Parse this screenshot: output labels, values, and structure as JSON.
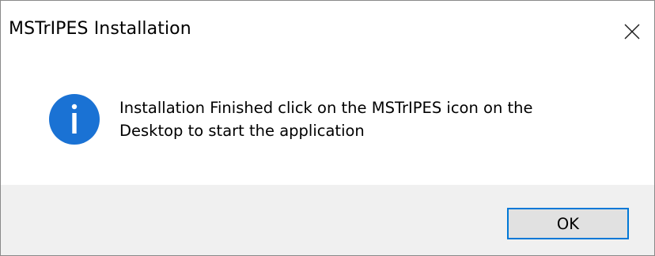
{
  "window": {
    "title": "MSTrIPES Installation",
    "close_icon": "close-icon"
  },
  "content": {
    "icon": "information-icon",
    "icon_color": "#1a72d4",
    "message_lines": [
      "Installation Finished click on the MSTrIPES icon on the",
      "Desktop to start the application"
    ]
  },
  "footer": {
    "ok_label": "OK",
    "focus_color": "#0078d7"
  }
}
